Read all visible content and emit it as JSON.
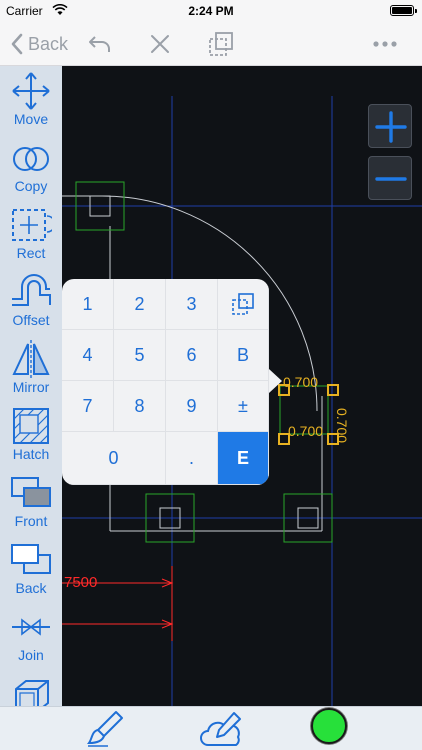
{
  "status_bar": {
    "carrier": "Carrier",
    "time": "2:24 PM",
    "battery_level": 1.0
  },
  "nav_bar": {
    "back_label": "Back",
    "icons": [
      "chevron-left-icon",
      "undo-icon",
      "close-icon",
      "duplicate-icon",
      "more-icon"
    ]
  },
  "sidebar": {
    "tools": [
      {
        "id": "move",
        "label": "Move",
        "icon": "move-icon"
      },
      {
        "id": "copy",
        "label": "Copy",
        "icon": "copy-icon"
      },
      {
        "id": "rect",
        "label": "Rect",
        "icon": "rect-select-icon"
      },
      {
        "id": "offset",
        "label": "Offset",
        "icon": "offset-icon"
      },
      {
        "id": "mirror",
        "label": "Mirror",
        "icon": "mirror-icon"
      },
      {
        "id": "hatch",
        "label": "Hatch",
        "icon": "hatch-icon"
      },
      {
        "id": "front",
        "label": "Front",
        "icon": "bring-front-icon"
      },
      {
        "id": "back",
        "label": "Back",
        "icon": "send-back-icon"
      },
      {
        "id": "join",
        "label": "Join",
        "icon": "join-icon"
      },
      {
        "id": "solid",
        "label": "",
        "icon": "3d-box-icon"
      }
    ]
  },
  "zoom": {
    "in_icon": "plus-icon",
    "out_icon": "minus-icon"
  },
  "keypad": {
    "keys": [
      [
        "1",
        "2",
        "3",
        "paste"
      ],
      [
        "4",
        "5",
        "6",
        "B"
      ],
      [
        "7",
        "8",
        "9",
        "±"
      ],
      [
        "0",
        ".",
        "E"
      ]
    ]
  },
  "dimensions": {
    "top": "0.700",
    "right": "0.700",
    "inner": "0.700",
    "red": "7500"
  },
  "bottom_bar": {
    "icons": [
      "brush-icon",
      "cloud-pen-icon",
      "color-swatch"
    ],
    "active_color": "#27e03a"
  },
  "colors": {
    "accent": "#1f6fd6",
    "canvas_bg": "#0f1216",
    "grip": "#e8b222",
    "dimension_red": "#ff2a2a",
    "node_green": "#2aa52a"
  }
}
